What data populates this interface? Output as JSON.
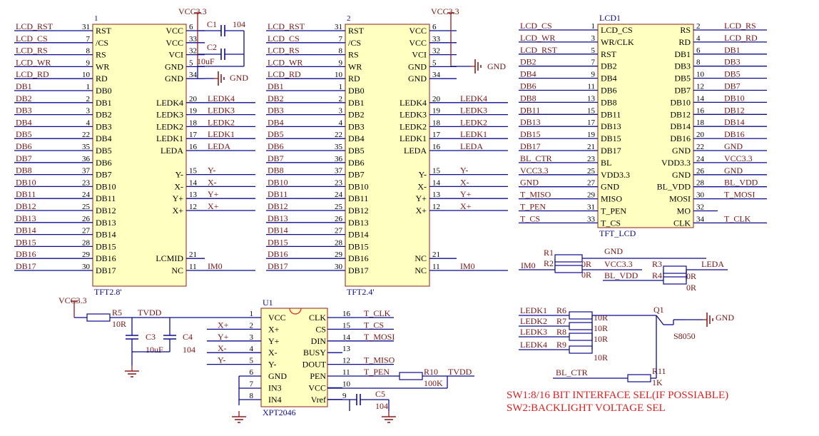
{
  "colors": {
    "wire": "#0b0b8c",
    "component": "#8b1f1f",
    "label": "#7a1414",
    "body_fill": "#ffffc0",
    "note": "#e02020",
    "pin_text": "#000000"
  },
  "ic1": {
    "designator": "1",
    "name": "TFT2.8'",
    "left": [
      {
        "net": "LCD_RST",
        "num": "31",
        "pin": "RST"
      },
      {
        "net": "LCD_CS",
        "num": "7",
        "pin": "/CS"
      },
      {
        "net": "LCD_RS",
        "num": "8",
        "pin": "RS"
      },
      {
        "net": "LCD_WR",
        "num": "9",
        "pin": "WR"
      },
      {
        "net": "LCD_RD",
        "num": "10",
        "pin": "RD"
      },
      {
        "net": "DB1",
        "num": "1",
        "pin": "DB0"
      },
      {
        "net": "DB2",
        "num": "2",
        "pin": "DB1"
      },
      {
        "net": "DB3",
        "num": "3",
        "pin": "DB2"
      },
      {
        "net": "DB4",
        "num": "4",
        "pin": "DB3"
      },
      {
        "net": "DB5",
        "num": "22",
        "pin": "DB4"
      },
      {
        "net": "DB6",
        "num": "35",
        "pin": "DB5"
      },
      {
        "net": "DB7",
        "num": "36",
        "pin": "DB6"
      },
      {
        "net": "DB8",
        "num": "37",
        "pin": "DB7"
      },
      {
        "net": "DB10",
        "num": "23",
        "pin": "DB10"
      },
      {
        "net": "DB11",
        "num": "24",
        "pin": "DB11"
      },
      {
        "net": "DB12",
        "num": "25",
        "pin": "DB12"
      },
      {
        "net": "DB13",
        "num": "26",
        "pin": "DB13"
      },
      {
        "net": "DB14",
        "num": "27",
        "pin": "DB14"
      },
      {
        "net": "DB15",
        "num": "28",
        "pin": "DB15"
      },
      {
        "net": "DB16",
        "num": "29",
        "pin": "DB16"
      },
      {
        "net": "DB17",
        "num": "30",
        "pin": "DB17"
      }
    ],
    "right": [
      {
        "row": 0,
        "pin": "VCC",
        "num": "6",
        "net": ""
      },
      {
        "row": 1,
        "pin": "VCC",
        "num": "33",
        "net": ""
      },
      {
        "row": 2,
        "pin": "VCI",
        "num": "32",
        "net": ""
      },
      {
        "row": 3,
        "pin": "GND",
        "num": "5",
        "net": ""
      },
      {
        "row": 4,
        "pin": "GND",
        "num": "34",
        "net": ""
      },
      {
        "row": 6,
        "pin": "LEDK4",
        "num": "20",
        "net": "LEDK4"
      },
      {
        "row": 7,
        "pin": "LEDK3",
        "num": "19",
        "net": "LEDK3"
      },
      {
        "row": 8,
        "pin": "LEDK2",
        "num": "18",
        "net": "LEDK2"
      },
      {
        "row": 9,
        "pin": "LEDK1",
        "num": "17",
        "net": "LEDK1"
      },
      {
        "row": 10,
        "pin": "LEDA",
        "num": "16",
        "net": "LEDA"
      },
      {
        "row": 12,
        "pin": "Y-",
        "num": "15",
        "net": "Y-"
      },
      {
        "row": 13,
        "pin": "X-",
        "num": "14",
        "net": "X-"
      },
      {
        "row": 14,
        "pin": "Y+",
        "num": "13",
        "net": "Y+"
      },
      {
        "row": 15,
        "pin": "X+",
        "num": "12",
        "net": "X+"
      },
      {
        "row": 19,
        "pin": "LCMID",
        "num": "21",
        "net": ""
      },
      {
        "row": 20,
        "pin": "NC",
        "num": "11",
        "net": "IM0"
      }
    ],
    "vcc": "VCC3.3",
    "gnd": "GND",
    "c1": "C1",
    "c1_val": "104",
    "c2": "C2",
    "c2_val": "10uF"
  },
  "ic2": {
    "designator": "2",
    "name": "TFT2.4'",
    "left": [
      {
        "net": "LCD_RST",
        "num": "31",
        "pin": "RST"
      },
      {
        "net": "LCD_CS",
        "num": "7",
        "pin": "/CS"
      },
      {
        "net": "LCD_RS",
        "num": "8",
        "pin": "RS"
      },
      {
        "net": "LCD_WR",
        "num": "9",
        "pin": "WR"
      },
      {
        "net": "LCD_RD",
        "num": "10",
        "pin": "RD"
      },
      {
        "net": "DB1",
        "num": "1",
        "pin": "DB0"
      },
      {
        "net": "DB2",
        "num": "2",
        "pin": "DB1"
      },
      {
        "net": "DB3",
        "num": "3",
        "pin": "DB2"
      },
      {
        "net": "DB4",
        "num": "4",
        "pin": "DB3"
      },
      {
        "net": "DB5",
        "num": "22",
        "pin": "DB4"
      },
      {
        "net": "DB6",
        "num": "35",
        "pin": "DB5"
      },
      {
        "net": "DB7",
        "num": "36",
        "pin": "DB6"
      },
      {
        "net": "DB8",
        "num": "37",
        "pin": "DB7"
      },
      {
        "net": "DB10",
        "num": "23",
        "pin": "DB10"
      },
      {
        "net": "DB11",
        "num": "24",
        "pin": "DB11"
      },
      {
        "net": "DB12",
        "num": "25",
        "pin": "DB12"
      },
      {
        "net": "DB13",
        "num": "26",
        "pin": "DB13"
      },
      {
        "net": "DB14",
        "num": "27",
        "pin": "DB14"
      },
      {
        "net": "DB15",
        "num": "28",
        "pin": "DB15"
      },
      {
        "net": "DB16",
        "num": "29",
        "pin": "DB16"
      },
      {
        "net": "DB17",
        "num": "30",
        "pin": "DB17"
      }
    ],
    "right": [
      {
        "row": 0,
        "pin": "VCC",
        "num": "6",
        "net": ""
      },
      {
        "row": 1,
        "pin": "VCC",
        "num": "33",
        "net": ""
      },
      {
        "row": 2,
        "pin": "VCI",
        "num": "32",
        "net": ""
      },
      {
        "row": 3,
        "pin": "GND",
        "num": "5",
        "net": ""
      },
      {
        "row": 4,
        "pin": "GND",
        "num": "34",
        "net": ""
      },
      {
        "row": 6,
        "pin": "LEDK4",
        "num": "20",
        "net": "LEDK4"
      },
      {
        "row": 7,
        "pin": "LEDK3",
        "num": "19",
        "net": "LEDK3"
      },
      {
        "row": 8,
        "pin": "LEDK2",
        "num": "18",
        "net": "LEDK2"
      },
      {
        "row": 9,
        "pin": "LEDK1",
        "num": "17",
        "net": "LEDK1"
      },
      {
        "row": 10,
        "pin": "LEDA",
        "num": "16",
        "net": "LEDA"
      },
      {
        "row": 12,
        "pin": "Y-",
        "num": "15",
        "net": "Y-"
      },
      {
        "row": 13,
        "pin": "X-",
        "num": "14",
        "net": "X-"
      },
      {
        "row": 14,
        "pin": "Y+",
        "num": "13",
        "net": "Y+"
      },
      {
        "row": 15,
        "pin": "X+",
        "num": "12",
        "net": "X+"
      },
      {
        "row": 19,
        "pin": "NC",
        "num": "21",
        "net": ""
      },
      {
        "row": 20,
        "pin": "NC",
        "num": "11",
        "net": "IM0"
      }
    ],
    "vcc": "VCC3.3",
    "gnd": "GND"
  },
  "lcd1": {
    "designator": "LCD1",
    "name": "TFT_LCD",
    "left": [
      {
        "net": "LCD_CS",
        "num": "1",
        "pin": "LCD_CS"
      },
      {
        "net": "LCD_WR",
        "num": "3",
        "pin": "WR/CLK"
      },
      {
        "net": "LCD_RST",
        "num": "5",
        "pin": "RST"
      },
      {
        "net": "DB2",
        "num": "7",
        "pin": "DB2"
      },
      {
        "net": "DB4",
        "num": "9",
        "pin": "DB4"
      },
      {
        "net": "DB6",
        "num": "11",
        "pin": "DB6"
      },
      {
        "net": "DB8",
        "num": "13",
        "pin": "DB8"
      },
      {
        "net": "DB11",
        "num": "15",
        "pin": "DB11"
      },
      {
        "net": "DB13",
        "num": "17",
        "pin": "DB13"
      },
      {
        "net": "DB15",
        "num": "19",
        "pin": "DB15"
      },
      {
        "net": "DB17",
        "num": "21",
        "pin": "DB17"
      },
      {
        "net": "BL_CTR",
        "num": "23",
        "pin": "BL"
      },
      {
        "net": "VCC3.3",
        "num": "25",
        "pin": "VDD3.3"
      },
      {
        "net": "GND",
        "num": "27",
        "pin": "GND"
      },
      {
        "net": "T_MISO",
        "num": "29",
        "pin": "MISO"
      },
      {
        "net": "T_PEN",
        "num": "31",
        "pin": "T_PEN"
      },
      {
        "net": "T_CS",
        "num": "33",
        "pin": "T_CS"
      }
    ],
    "right": [
      {
        "pin": "RS",
        "num": "2",
        "net": "LCD_RS"
      },
      {
        "pin": "RD",
        "num": "4",
        "net": "LCD_RD"
      },
      {
        "pin": "DB1",
        "num": "6",
        "net": "DB1"
      },
      {
        "pin": "DB3",
        "num": "8",
        "net": "DB3"
      },
      {
        "pin": "DB5",
        "num": "10",
        "net": "DB5"
      },
      {
        "pin": "DB7",
        "num": "12",
        "net": "DB7"
      },
      {
        "pin": "DB10",
        "num": "14",
        "net": "DB10"
      },
      {
        "pin": "DB12",
        "num": "16",
        "net": "DB12"
      },
      {
        "pin": "DB14",
        "num": "18",
        "net": "DB14"
      },
      {
        "pin": "DB16",
        "num": "20",
        "net": "DB16"
      },
      {
        "pin": "GND",
        "num": "22",
        "net": "GND"
      },
      {
        "pin": "VDD3.3",
        "num": "24",
        "net": "VCC3.3"
      },
      {
        "pin": "GND",
        "num": "26",
        "net": "GND"
      },
      {
        "pin": "BL_VDD",
        "num": "28",
        "net": "BL_VDD"
      },
      {
        "pin": "MOSI",
        "num": "30",
        "net": "T_MOSI"
      },
      {
        "pin": "MO",
        "num": "32",
        "net": ""
      },
      {
        "pin": "CLK",
        "num": "34",
        "net": "T_CLK"
      }
    ]
  },
  "im0_block": {
    "net": "IM0",
    "r1": "R1",
    "r2": "R2",
    "r1_val": "0R",
    "r2_val": "0R",
    "gnd": "GND",
    "vcc": "VCC3.3"
  },
  "leda_block": {
    "net_in": "BL_VDD",
    "r3": "R3",
    "r4": "R4",
    "r3_val": "0R",
    "r4_val": "0R",
    "net_out": "LEDA"
  },
  "backlight": {
    "nets": [
      "LEDK1",
      "LEDK2",
      "LEDK3",
      "LEDK4"
    ],
    "resistors": [
      "R6",
      "R7",
      "R8",
      "R9"
    ],
    "values": [
      "10R",
      "10R",
      "10R",
      "10R"
    ],
    "q": "Q1",
    "q_part": "S8050",
    "gnd": "GND",
    "ctrl_net": "BL_CTR",
    "r11": "R11",
    "r11_val": "1K"
  },
  "touch": {
    "designator": "U1",
    "name": "XPT2046",
    "vcc": "VCC3.3",
    "r5": "R5",
    "r5_val": "10R",
    "tvdd": "TVDD",
    "c3": "C3",
    "c3_val": "10uF",
    "c4": "C4",
    "c4_val": "104",
    "c5": "C5",
    "c5_val": "104",
    "r10": "R10",
    "r10_val": "100K",
    "r10_net": "TVDD",
    "left": [
      {
        "net": "",
        "num": "1",
        "pin": "VCC"
      },
      {
        "net": "X+",
        "num": "2",
        "pin": "X+"
      },
      {
        "net": "Y+",
        "num": "3",
        "pin": "Y+"
      },
      {
        "net": "X-",
        "num": "4",
        "pin": "X-"
      },
      {
        "net": "Y-",
        "num": "5",
        "pin": "Y-"
      },
      {
        "net": "",
        "num": "6",
        "pin": "GND"
      },
      {
        "net": "",
        "num": "7",
        "pin": "IN3"
      },
      {
        "net": "",
        "num": "8",
        "pin": "IN4"
      }
    ],
    "right": [
      {
        "pin": "CLK",
        "num": "16",
        "net": "T_CLK"
      },
      {
        "pin": "CS",
        "num": "15",
        "net": "T_CS"
      },
      {
        "pin": "DIN",
        "num": "14",
        "net": "T_MOSI"
      },
      {
        "pin": "BUSY",
        "num": "13",
        "net": ""
      },
      {
        "pin": "DOUT",
        "num": "12",
        "net": "T_MISO"
      },
      {
        "pin": "PEN",
        "num": "11",
        "net": "T_PEN"
      },
      {
        "pin": "VCC",
        "num": "10",
        "net": ""
      },
      {
        "pin": "Vref",
        "num": "9",
        "net": ""
      }
    ]
  },
  "notes": [
    "SW1:8/16 BIT INTERFACE SEL(IF POSSIABLE)",
    "SW2:BACKLIGHT VOLTAGE SEL"
  ]
}
